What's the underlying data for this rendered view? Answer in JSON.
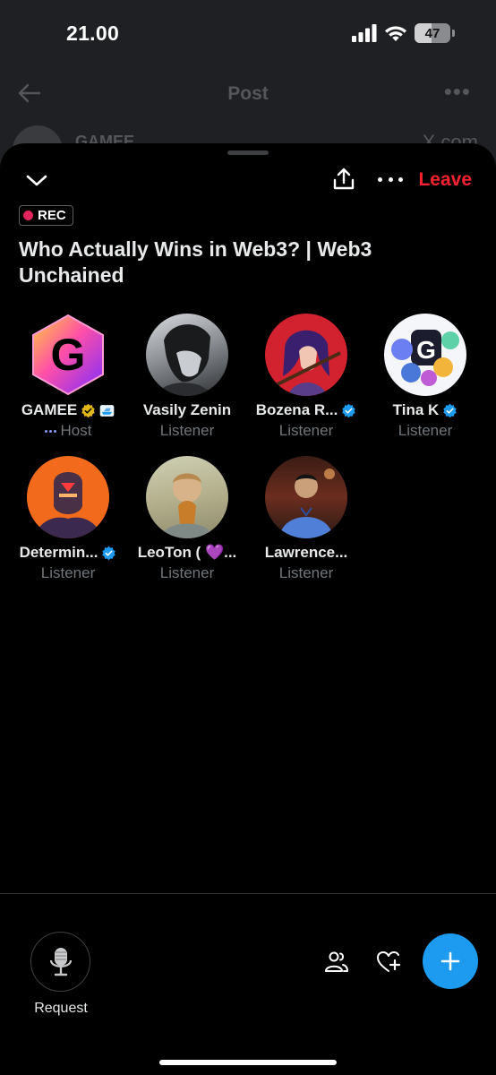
{
  "status_bar": {
    "time": "21.00",
    "battery": "47",
    "battery_level": 0.47
  },
  "background_post": {
    "title": "Post",
    "peek_name": "GAMEE",
    "peek_right": "X.com"
  },
  "sheet": {
    "leave_label": "Leave",
    "rec_label": "REC",
    "title": "Who Actually Wins in Web3? | Web3 Unchained"
  },
  "participants": [
    {
      "name": "GAMEE",
      "role": "Host",
      "badge": "gold-verified",
      "extra_emoji": "🚤"
    },
    {
      "name": "Vasily Zenin",
      "role": "Listener",
      "badge": "none"
    },
    {
      "name": "Bozena R...",
      "role": "Listener",
      "badge": "blue-verified"
    },
    {
      "name": "Tina K",
      "role": "Listener",
      "badge": "blue-verified"
    },
    {
      "name": "Determin...",
      "role": "Listener",
      "badge": "blue-verified"
    },
    {
      "name": "LeoTon ( 💜...",
      "role": "Listener",
      "badge": "none"
    },
    {
      "name": "Lawrence...",
      "role": "Listener",
      "badge": "none"
    }
  ],
  "footer": {
    "request_label": "Request"
  },
  "colors": {
    "accent": "#1d9bf0",
    "leave": "#f4212e",
    "rec_dot": "#e0245e",
    "muted": "#71767b"
  },
  "icons": [
    "back-arrow-icon",
    "chevron-down-icon",
    "share-icon",
    "more-icon",
    "microphone-icon",
    "people-icon",
    "heart-plus-icon",
    "plus-icon",
    "verified-icon"
  ]
}
